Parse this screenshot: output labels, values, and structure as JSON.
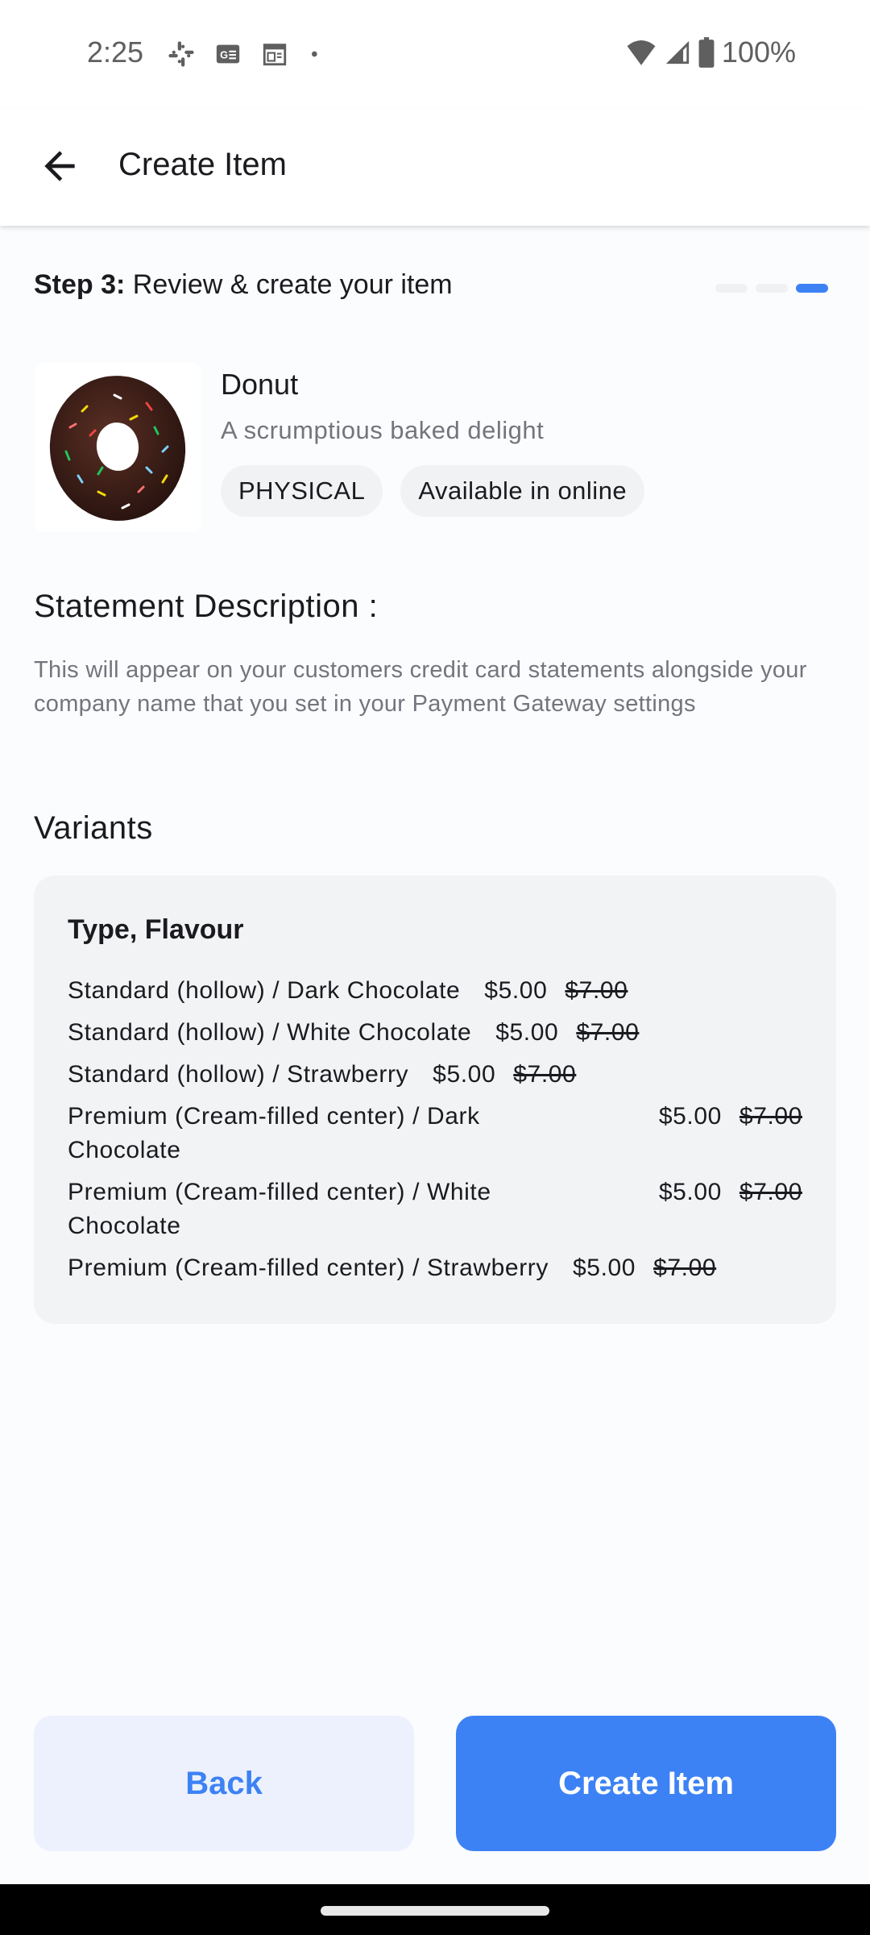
{
  "status_bar": {
    "time": "2:25",
    "left_icons": [
      "slack-icon",
      "news-card-icon",
      "calendar-icon",
      "dot-icon"
    ],
    "right_icons": [
      "wifi-icon",
      "signal-icon",
      "battery-icon"
    ],
    "battery": "100%"
  },
  "app_bar": {
    "back_icon": "arrow-back-icon",
    "title": "Create Item"
  },
  "step": {
    "label": "Step 3:",
    "text": " Review & create your item",
    "current": 3,
    "total": 3
  },
  "item": {
    "image": "donut-image",
    "name": "Donut",
    "subtitle": "A scrumptious baked delight",
    "chips": [
      "PHYSICAL",
      "Available in online"
    ]
  },
  "statement": {
    "title": "Statement Description :",
    "description": "This will appear on your customers credit card statements alongside your company name that you set in your Payment Gateway settings"
  },
  "variants": {
    "title": "Variants",
    "header": "Type, Flavour",
    "rows": [
      {
        "name": "Standard (hollow) / Dark Chocolate",
        "price": "$5.00",
        "compare_price": "$7.00",
        "wrap": false
      },
      {
        "name": "Standard (hollow) / White Chocolate",
        "price": "$5.00",
        "compare_price": "$7.00",
        "wrap": false
      },
      {
        "name": "Standard (hollow) / Strawberry",
        "price": "$5.00",
        "compare_price": "$7.00",
        "wrap": false
      },
      {
        "name": "Premium (Cream-filled center) / Dark Chocolate",
        "price": "$5.00",
        "compare_price": "$7.00",
        "wrap": true
      },
      {
        "name": "Premium (Cream-filled center) / White Chocolate",
        "price": "$5.00",
        "compare_price": "$7.00",
        "wrap": true
      },
      {
        "name": "Premium (Cream-filled center) / Strawberry",
        "price": "$5.00",
        "compare_price": "$7.00",
        "wrap": false
      }
    ]
  },
  "actions": {
    "back_label": "Back",
    "create_label": "Create Item"
  },
  "colors": {
    "accent": "#3d82f5",
    "secondary_button_bg": "#edf1fd",
    "card_bg": "#f2f3f5"
  }
}
